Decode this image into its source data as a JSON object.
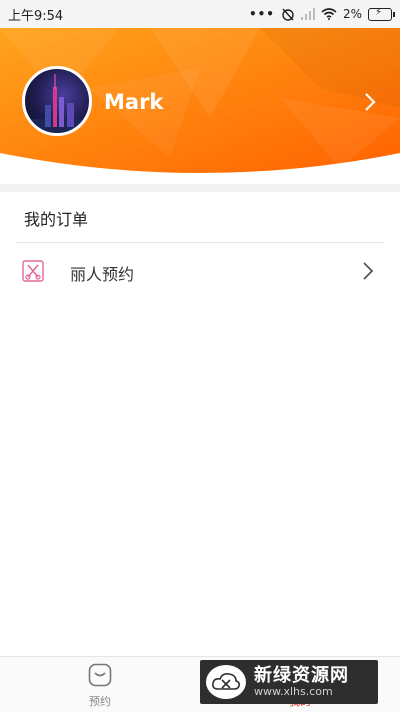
{
  "status_bar": {
    "time": "上午9:54",
    "dots": "•••",
    "battery_percent": "2%",
    "icons": [
      "alarm-off-icon",
      "signal-icon",
      "wifi-icon",
      "battery-charging-icon"
    ]
  },
  "header": {
    "username": "Mark",
    "gradient_colors": [
      "#ff9a1a",
      "#ff6a00"
    ],
    "avatar_icon": "user-avatar-photo",
    "chevron_icon": "chevron-right-icon"
  },
  "orders": {
    "title": "我的订单",
    "items": [
      {
        "label": "丽人预约",
        "icon": "scissors-comb-icon",
        "icon_color": "#e06a9a"
      }
    ]
  },
  "bottom_nav": {
    "tabs": [
      {
        "label": "预约",
        "icon": "appointment-face-icon",
        "active": false
      },
      {
        "label": "我的",
        "icon": "profile-icon",
        "active": true,
        "active_color": "#e2332c"
      }
    ]
  },
  "watermark": {
    "title": "新绿资源网",
    "url": "www.xlhs.com"
  }
}
